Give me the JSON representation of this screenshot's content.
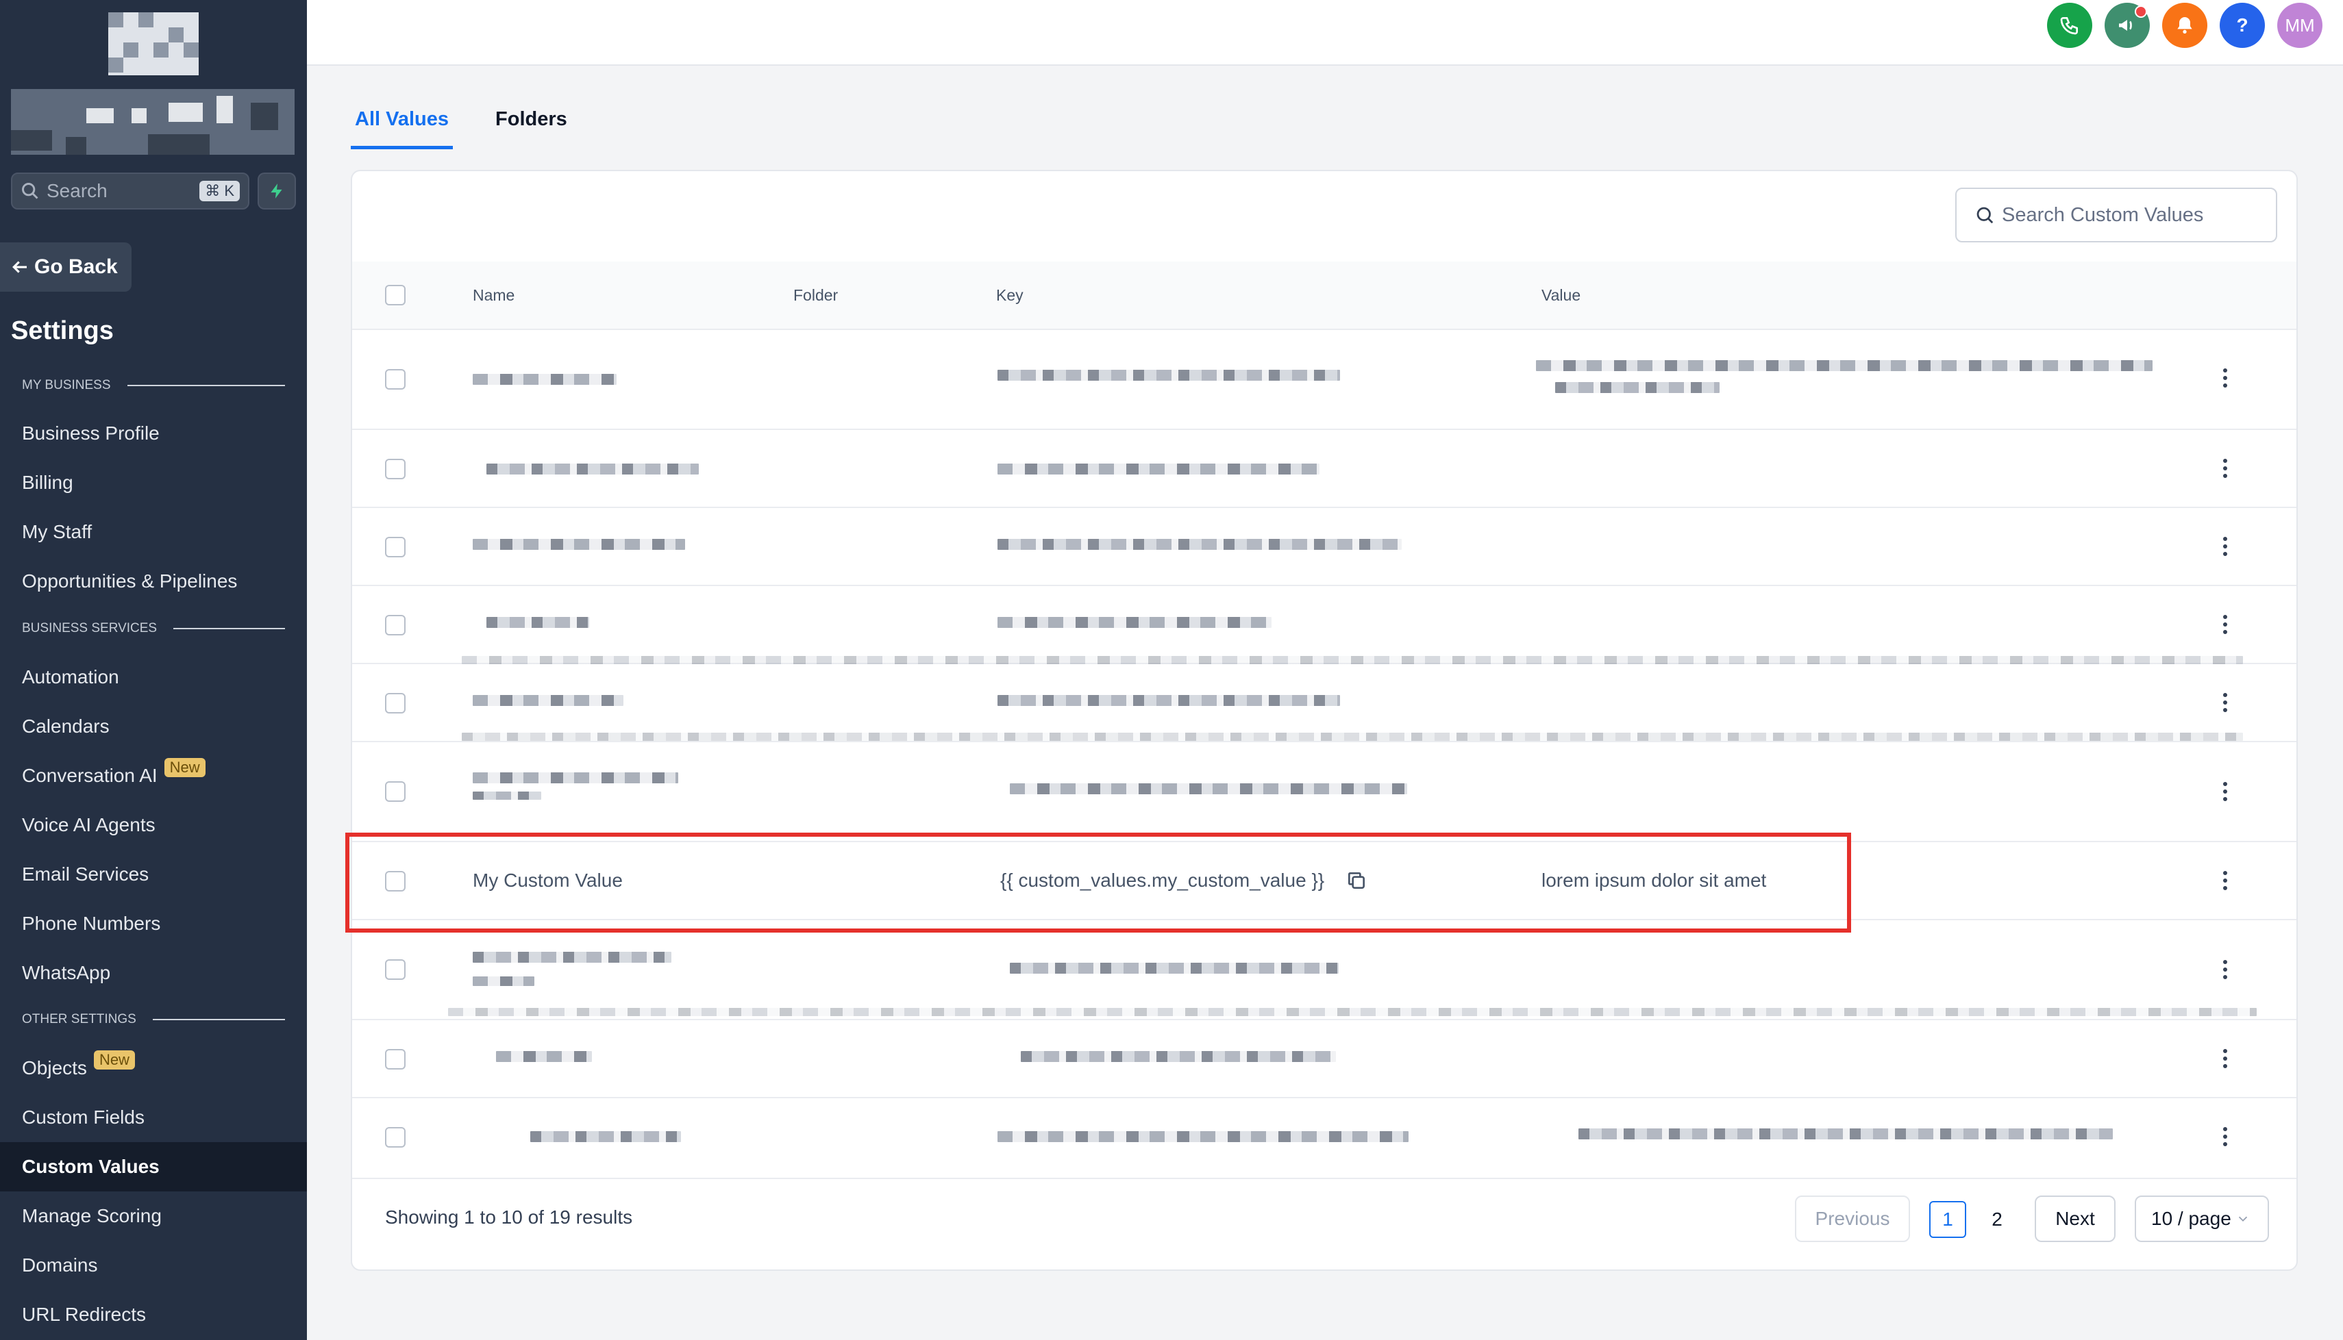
{
  "sidebar": {
    "search_placeholder": "Search",
    "search_shortcut": "⌘ K",
    "go_back": "Go Back",
    "title": "Settings",
    "sections": {
      "my_business": "MY BUSINESS",
      "business_services": "BUSINESS SERVICES",
      "other_settings": "OTHER SETTINGS"
    },
    "items": {
      "business_profile": "Business Profile",
      "billing": "Billing",
      "my_staff": "My Staff",
      "opportunities": "Opportunities & Pipelines",
      "automation": "Automation",
      "calendars": "Calendars",
      "conversation_ai": "Conversation AI",
      "voice_ai": "Voice AI Agents",
      "email_services": "Email Services",
      "phone_numbers": "Phone Numbers",
      "whatsapp": "WhatsApp",
      "objects": "Objects",
      "custom_fields": "Custom Fields",
      "custom_values": "Custom Values",
      "manage_scoring": "Manage Scoring",
      "domains": "Domains",
      "url_redirects": "URL Redirects"
    },
    "new_badge": "New"
  },
  "topbar": {
    "avatar_initials": "MM",
    "help_label": "?",
    "colors": {
      "phone": "#16a34a",
      "announce": "#3f8f6f",
      "bell": "#f97316",
      "help": "#2563eb",
      "avatar": "#c084d6"
    }
  },
  "tabs": {
    "all_values": "All Values",
    "folders": "Folders"
  },
  "table": {
    "search_placeholder": "Search Custom Values",
    "columns": {
      "name": "Name",
      "folder": "Folder",
      "key": "Key",
      "value": "Value"
    },
    "highlighted_row": {
      "name": "My Custom Value",
      "key": "{{ custom_values.my_custom_value }}",
      "value": "lorem ipsum dolor sit amet"
    }
  },
  "pagination": {
    "summary": "Showing 1 to 10 of 19 results",
    "previous": "Previous",
    "page1": "1",
    "page2": "2",
    "next": "Next",
    "page_size": "10 / page"
  },
  "colors": {
    "accent": "#1570ef",
    "sidebar_bg": "#253043",
    "highlight": "#e5302b",
    "badge": "#e9c46a"
  }
}
